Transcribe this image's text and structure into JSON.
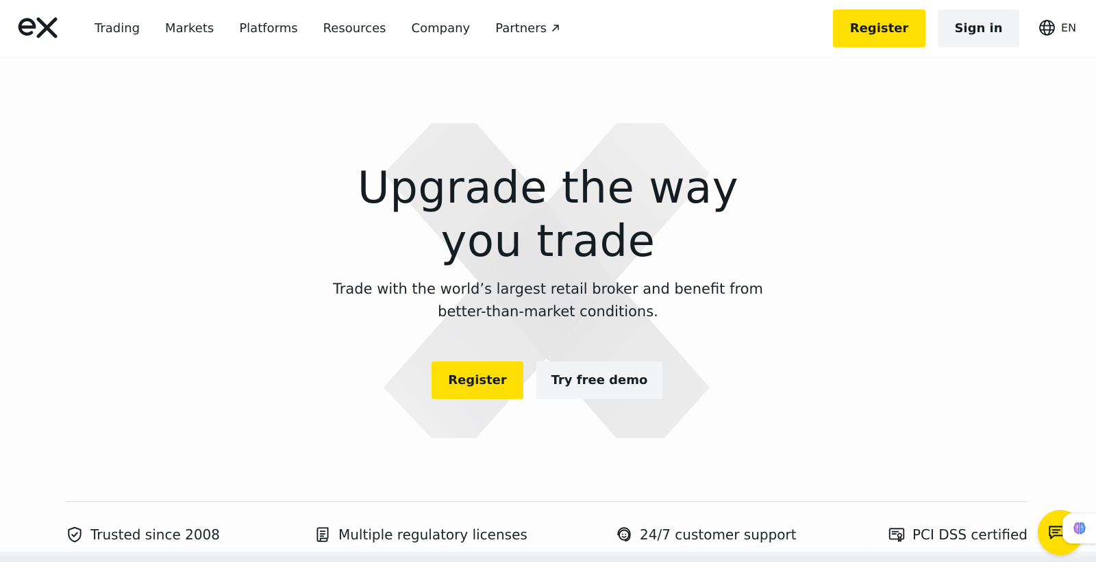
{
  "brand": {
    "logo_text": "ex"
  },
  "nav": {
    "items": [
      {
        "label": "Trading"
      },
      {
        "label": "Markets"
      },
      {
        "label": "Platforms"
      },
      {
        "label": "Resources"
      },
      {
        "label": "Company"
      },
      {
        "label": "Partners",
        "icon": "arrow-up-right-icon"
      }
    ]
  },
  "header": {
    "register_label": "Register",
    "signin_label": "Sign in",
    "language": "EN",
    "language_icon": "globe-icon"
  },
  "hero": {
    "title_line1": "Upgrade the way",
    "title_line2": "you trade",
    "subtitle_line1": "Trade with the world’s largest retail broker and benefit from",
    "subtitle_line2": "better-than-market conditions.",
    "register_label": "Register",
    "demo_label": "Try free demo"
  },
  "features": [
    {
      "icon": "shield-check-icon",
      "label": "Trusted since 2008"
    },
    {
      "icon": "license-scroll-icon",
      "label": "Multiple regulatory licenses"
    },
    {
      "icon": "support-headset-icon",
      "label": "24/7 customer support"
    },
    {
      "icon": "certificate-icon",
      "label": "PCI DSS certified"
    }
  ],
  "chat": {
    "icon": "chat-icon",
    "badge_icon": "brain-icon"
  },
  "colors": {
    "accent": "#ffde02",
    "text": "#141d22",
    "secondary_button": "#f3f4f5"
  }
}
